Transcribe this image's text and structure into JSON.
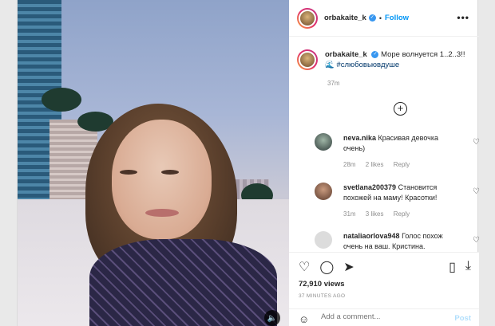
{
  "header": {
    "username": "orbakaite_k",
    "separator": "•",
    "follow_label": "Follow",
    "more_icon": "ellipsis-icon"
  },
  "caption": {
    "username": "orbakaite_k",
    "text": "Море волнуется 1..2..3!! 🌊",
    "hashtag": "#слюбовьювдуше",
    "time": "37m"
  },
  "load_more_icon": "plus-circle-icon",
  "comments": [
    {
      "username": "neva.nika",
      "text": "Красивая девочка очень)",
      "time": "28m",
      "likes": "2 likes",
      "reply": "Reply"
    },
    {
      "username": "svetlana200379",
      "text": "Становится похожей на маму! Красотки!",
      "time": "31m",
      "likes": "3 likes",
      "reply": "Reply"
    },
    {
      "username": "nataliaorlova948",
      "text": "Голос похож очень на ваш. Кристина."
    }
  ],
  "actions": {
    "views": "72,910 views",
    "posted": "37 MINUTES AGO"
  },
  "add_comment": {
    "placeholder": "Add a comment...",
    "post_label": "Post"
  },
  "colors": {
    "link_blue": "#0095f6",
    "hashtag": "#00376b",
    "muted": "#8e8e8e"
  }
}
